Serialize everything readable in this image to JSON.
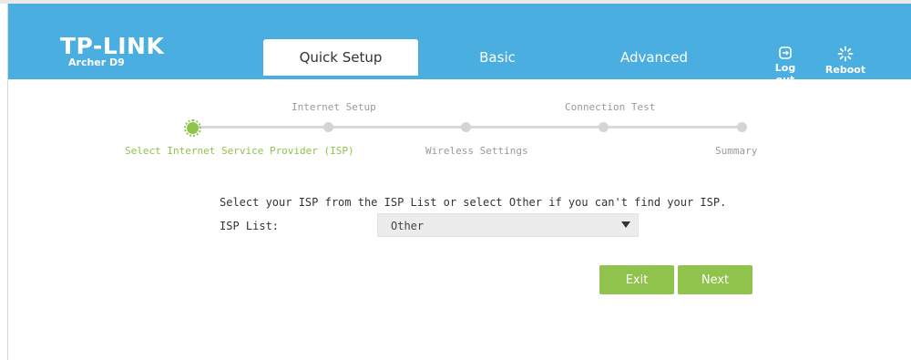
{
  "brand": {
    "name": "TP-LINK",
    "model": "Archer D9"
  },
  "tabs": [
    {
      "label": "Quick Setup",
      "active": true
    },
    {
      "label": "Basic",
      "active": false
    },
    {
      "label": "Advanced",
      "active": false
    }
  ],
  "header_actions": {
    "logout_label": "Log out",
    "reboot_label": "Reboot"
  },
  "steps": {
    "top_labels": [
      "Internet Setup",
      "Connection Test"
    ],
    "bottom_labels": [
      "Select Internet Service Provider (ISP)",
      "Wireless Settings",
      "Summary"
    ],
    "active_step": "Select Internet Service Provider (ISP)"
  },
  "form": {
    "instruction": "Select your ISP from the ISP List or select Other if you can't find your ISP.",
    "isp_label": "ISP List:",
    "isp_value": "Other"
  },
  "buttons": {
    "exit": "Exit",
    "next": "Next"
  },
  "colors": {
    "header": "#4aaee0",
    "accent": "#8fc34c",
    "inactive": "#d4d4d4"
  },
  "icons": {
    "logout": "logout-icon",
    "reboot": "reboot-icon",
    "dropdown": "caret-down-icon"
  }
}
